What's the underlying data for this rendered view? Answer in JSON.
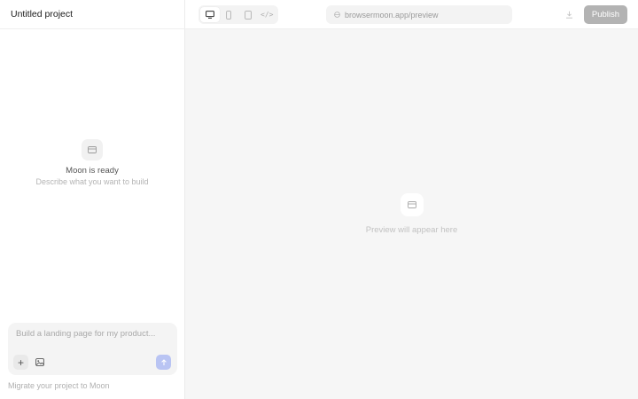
{
  "project": {
    "title": "Untitled project"
  },
  "chat_empty": {
    "icon": "card-icon",
    "title": "Moon is ready",
    "subtitle": "Describe what you want to build"
  },
  "composer": {
    "placeholder": "Build a landing page for my product...",
    "value": "",
    "add_icon": "plus-icon",
    "image_icon": "image-icon",
    "send_icon": "arrow-up-icon"
  },
  "footer": {
    "migrate_text": "Migrate your project to Moon"
  },
  "toolbar": {
    "devices": [
      {
        "name": "desktop",
        "icon": "monitor-icon",
        "active": true
      },
      {
        "name": "mobile",
        "icon": "phone-icon",
        "active": false
      },
      {
        "name": "tablet",
        "icon": "tablet-icon",
        "active": false
      },
      {
        "name": "code",
        "label": "</>",
        "active": false
      }
    ],
    "url": "browsermoon.app/preview",
    "url_icon": "globe-icon",
    "download_icon": "download-icon",
    "publish_label": "Publish"
  },
  "preview": {
    "icon": "card-icon",
    "placeholder_text": "Preview will appear here"
  },
  "colors": {
    "accent_send": "#b9c4f3",
    "publish_disabled": "#b3b3b3",
    "preview_bg": "#f6f6f6"
  }
}
